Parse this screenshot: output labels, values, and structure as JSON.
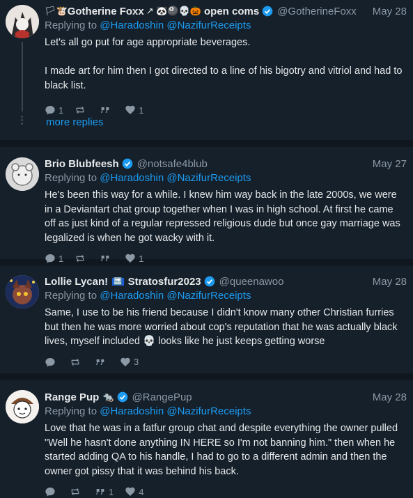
{
  "posts": [
    {
      "name": "Gotherine Foxx",
      "name_prefix": "🏳🐮",
      "name_badges": "↗ 🐼🎱💀🎃",
      "name_suffix": "open coms",
      "handle": "@GotherineFoxx",
      "date": "May 28",
      "reply_prefix": "Replying to",
      "reply_to": [
        "@Haradoshin",
        "@NazifurReceipts"
      ],
      "text": "Let's all go put for age appropriate beverages.\n\nI made art for him then I got directed to a line of his bigotry and vitriol and had to black list.",
      "replies": "1",
      "reposts": "",
      "quotes": "",
      "likes": "1"
    },
    {
      "name": "Brio Blubfeesh",
      "handle": "@notsafe4blub",
      "date": "May 27",
      "reply_prefix": "Replying to",
      "reply_to": [
        "@Haradoshin",
        "@NazifurReceipts"
      ],
      "text": "He's been this way for a while. I knew him way back in the late 2000s, we were in a Deviantart chat group together when I was in high school. At first he came off as just kind of a regular repressed religious dude but once gay marriage was legalized is when he got wacky with it.",
      "replies": "1",
      "reposts": "",
      "quotes": "",
      "likes": "1"
    },
    {
      "name": "Lollie Lycan!",
      "name_badges": "🔜",
      "name_suffix": "Stratosfur2023",
      "handle": "@queenawoo",
      "date": "May 28",
      "reply_prefix": "Replying to",
      "reply_to": [
        "@Haradoshin",
        "@NazifurReceipts"
      ],
      "text": "Same, I use to be his friend because I didn't know many other Christian furries but then he was more worried about cop's reputation that he was actually black lives, myself included 💀 looks like he just keeps getting worse",
      "replies": "",
      "reposts": "",
      "quotes": "",
      "likes": "3"
    },
    {
      "name": "Range Pup",
      "name_badges": "🐀",
      "handle": "@RangePup",
      "date": "May 28",
      "reply_prefix": "Replying to",
      "reply_to": [
        "@Haradoshin",
        "@NazifurReceipts"
      ],
      "text": "Love that he was in a fatfur group chat and despite everything the owner pulled \"Well he hasn't done anything IN HERE so I'm not banning him.\" then when he started adding QA to his handle, I had to go to a different admin and then the owner got pissy that it was behind his back.",
      "replies": "",
      "reposts": "",
      "quotes": "1",
      "likes": "4"
    }
  ],
  "more_replies": "more replies",
  "colors": {
    "background": "#15202b",
    "accent": "#1d9bf0",
    "muted": "#8b98a5",
    "verified": "#1d9bf0"
  },
  "icons": [
    "reply-icon",
    "repost-icon",
    "quote-icon",
    "like-icon",
    "verified-icon",
    "avatar"
  ]
}
